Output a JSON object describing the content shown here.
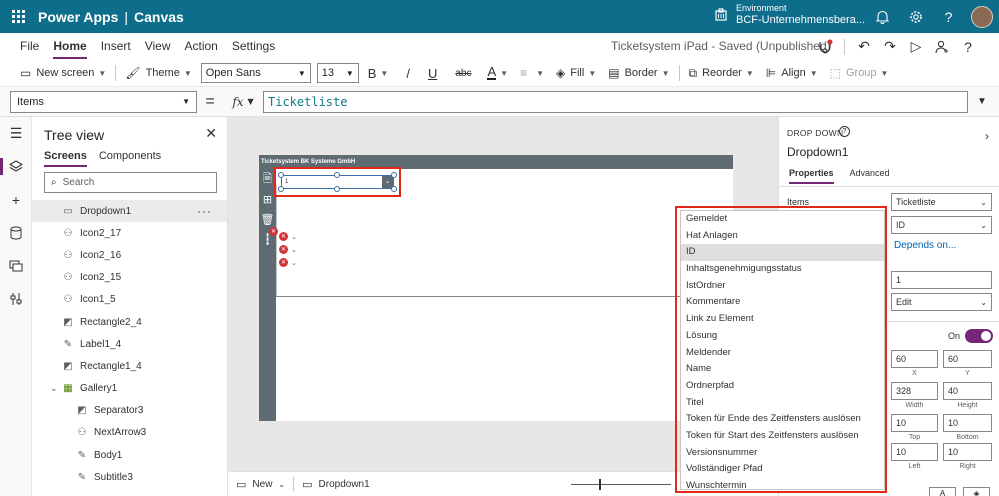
{
  "app": {
    "name": "Power Apps",
    "separator": "|",
    "mode": "Canvas"
  },
  "environment": {
    "label": "Environment",
    "name": "BCF-Unternehmensbera..."
  },
  "menu": {
    "tabs": [
      {
        "label": "File"
      },
      {
        "label": "Home"
      },
      {
        "label": "Insert"
      },
      {
        "label": "View"
      },
      {
        "label": "Action"
      },
      {
        "label": "Settings"
      }
    ],
    "active_tab": "Home",
    "doc_title": "Ticketsystem iPad - Saved (Unpublished)"
  },
  "toolbar": {
    "new_screen": "New screen",
    "theme": "Theme",
    "font": "Open Sans",
    "font_size": "13",
    "bold": "B",
    "italic": "/",
    "underline": "U",
    "strike": "abc",
    "font_color": "A",
    "fill": "Fill",
    "border": "Border",
    "reorder": "Reorder",
    "align": "Align",
    "group": "Group"
  },
  "formula_bar": {
    "property": "Items",
    "equals": "=",
    "fx": "fx",
    "formula": "Ticketliste"
  },
  "tree": {
    "title": "Tree view",
    "tabs": [
      "Screens",
      "Components"
    ],
    "search_placeholder": "Search",
    "items": [
      {
        "label": "Dropdown1",
        "icon": "dropdown-icon",
        "selected": true,
        "indent": 0
      },
      {
        "label": "Icon2_17",
        "icon": "icon-control-icon",
        "indent": 0
      },
      {
        "label": "Icon2_16",
        "icon": "icon-control-icon",
        "indent": 0
      },
      {
        "label": "Icon2_15",
        "icon": "icon-control-icon",
        "indent": 0
      },
      {
        "label": "Icon1_5",
        "icon": "icon-control-icon",
        "indent": 0
      },
      {
        "label": "Rectangle2_4",
        "icon": "rectangle-icon",
        "indent": 0
      },
      {
        "label": "Label1_4",
        "icon": "label-icon",
        "indent": 0
      },
      {
        "label": "Rectangle1_4",
        "icon": "rectangle-icon",
        "indent": 0
      },
      {
        "label": "Gallery1",
        "icon": "gallery-icon",
        "indent": 0,
        "expanded": true
      },
      {
        "label": "Separator3",
        "icon": "rectangle-icon",
        "indent": 1
      },
      {
        "label": "NextArrow3",
        "icon": "icon-control-icon",
        "indent": 1
      },
      {
        "label": "Body1",
        "icon": "label-icon",
        "indent": 1
      },
      {
        "label": "Subtitle3",
        "icon": "label-icon",
        "indent": 1
      }
    ]
  },
  "canvas": {
    "screen_title": "Ticketsystem BK Systeme GmbH",
    "dropdown_value": "1"
  },
  "dropdown_popup": {
    "items": [
      "Gemeldet",
      "Hat Anlagen",
      "ID",
      "Inhaltsgenehmigungsstatus",
      "IstOrdner",
      "Kommentare",
      "Link zu Element",
      "Lösung",
      "Meldender",
      "Name",
      "Ordnerpfad",
      "Titel",
      "Token für Ende des Zeitfensters auslösen",
      "Token für Start des Zeitfensters auslösen",
      "Versionsnummer",
      "Vollständiger Pfad",
      "Wunschtermin"
    ],
    "highlighted": "ID"
  },
  "statusbar": {
    "new_label": "New",
    "control_label": "Dropdown1"
  },
  "properties": {
    "type_label": "DROP DOWN",
    "control_name": "Dropdown1",
    "tabs": [
      "Properties",
      "Advanced"
    ],
    "items_label": "Items",
    "items_value": "Ticketliste",
    "value_value": "ID",
    "depends_on": "Depends on...",
    "default_value": "1",
    "mode_value": "Edit",
    "toggle_label": "On",
    "x": "60",
    "y": "60",
    "x_cap": "X",
    "y_cap": "Y",
    "width": "328",
    "height": "40",
    "width_cap": "Width",
    "height_cap": "Height",
    "pad_top": "10",
    "pad_bottom": "10",
    "top_cap": "Top",
    "bottom_cap": "Bottom",
    "pad_left": "10",
    "pad_right": "10",
    "left_cap": "Left",
    "right_cap": "Right"
  },
  "colors": {
    "topbar": "#0e6d8a",
    "accent": "#742774",
    "annotation_red": "#e0281b",
    "screen_header": "#5f6b73"
  }
}
